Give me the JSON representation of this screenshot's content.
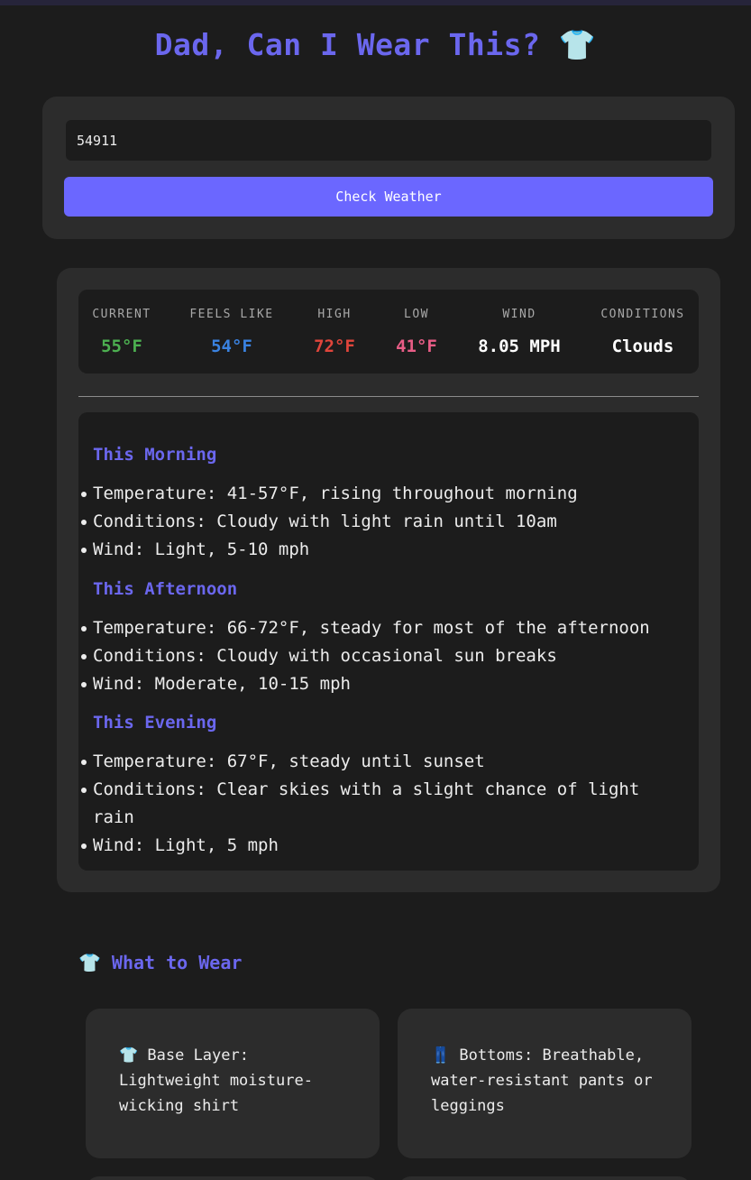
{
  "app": {
    "title": "Dad, Can I Wear This? 👕"
  },
  "search": {
    "zip_value": "54911",
    "button_label": "Check Weather"
  },
  "stats": [
    {
      "label": "CURRENT",
      "value": "55°F",
      "color": "#4caf50"
    },
    {
      "label": "FEELS LIKE",
      "value": "54°F",
      "color": "#3a82e0"
    },
    {
      "label": "HIGH",
      "value": "72°F",
      "color": "#e0453b"
    },
    {
      "label": "LOW",
      "value": "41°F",
      "color": "#e85d86"
    },
    {
      "label": "WIND",
      "value": "8.05 MPH",
      "color": "#ffffff"
    },
    {
      "label": "CONDITIONS",
      "value": "Clouds",
      "color": "#ffffff"
    }
  ],
  "forecast": {
    "morning": {
      "title": "This Morning",
      "items": [
        "Temperature: 41-57°F, rising throughout morning",
        "Conditions: Cloudy with light rain until 10am",
        "Wind: Light, 5-10 mph"
      ]
    },
    "afternoon": {
      "title": "This Afternoon",
      "items": [
        "Temperature: 66-72°F, steady for most of the afternoon",
        "Conditions: Cloudy with occasional sun breaks",
        "Wind: Moderate, 10-15 mph"
      ]
    },
    "evening": {
      "title": "This Evening",
      "items": [
        "Temperature: 67°F, steady until sunset",
        "Conditions: Clear skies with a slight chance of light rain",
        "Wind: Light, 5 mph"
      ]
    }
  },
  "wear": {
    "heading_icon": "👕",
    "heading": "What to Wear",
    "cards": [
      {
        "text": "👕 Base Layer: Lightweight moisture-wicking shirt"
      },
      {
        "text": "👖 Bottoms: Breathable, water-resistant pants or leggings"
      }
    ]
  }
}
